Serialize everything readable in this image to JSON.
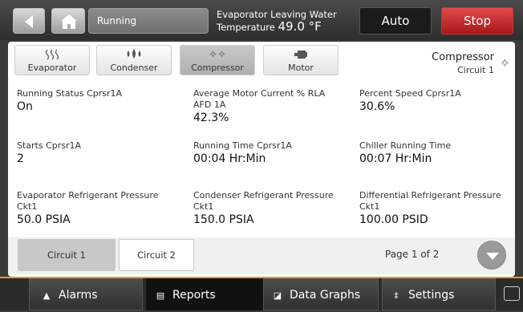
{
  "header": {
    "status": "Running",
    "evap_label": "Evaporator Leaving Water",
    "evap_temp_prefix": "Temperature",
    "evap_temp_value": "49.0 °F",
    "auto_label": "Auto",
    "stop_label": "Stop",
    "colors": {
      "stop": "#c62828",
      "accent": "#e69a1e"
    }
  },
  "tabs": [
    {
      "label": "Evaporator",
      "icon": "evaporator-icon"
    },
    {
      "label": "Condenser",
      "icon": "condenser-icon"
    },
    {
      "label": "Compressor",
      "icon": "compressor-icon",
      "active": true
    },
    {
      "label": "Motor",
      "icon": "motor-icon"
    }
  ],
  "component": {
    "title": "Compressor",
    "subtitle": "Circuit 1",
    "icon": "compressor-icon"
  },
  "readings": [
    {
      "label": "Running Status Cprsr1A",
      "value": "On"
    },
    {
      "label": "Average Motor Current % RLA",
      "label2": "AFD 1A",
      "value": "42.3%"
    },
    {
      "label": "Percent Speed Cprsr1A",
      "value": "30.6%"
    },
    {
      "label": "Starts Cprsr1A",
      "value": "2"
    },
    {
      "label": "Running Time Cprsr1A",
      "value": "00:04 Hr:Min"
    },
    {
      "label": "Chiller Running Time",
      "value": "00:07 Hr:Min"
    },
    {
      "label": "Evaporator Refrigerant Pressure",
      "label2": "Ckt1",
      "value": "50.0 PSIA"
    },
    {
      "label": "Condenser Refrigerant Pressure",
      "label2": "Ckt1",
      "value": "150.0 PSIA"
    },
    {
      "label": "Differential Refrigerant Pressure",
      "label2": "Ckt1",
      "value": "100.00 PSID"
    }
  ],
  "circuits": [
    "Circuit 1",
    "Circuit 2"
  ],
  "pagination": {
    "label": "Page 1 of 2"
  },
  "nav": [
    {
      "label": "Alarms",
      "icon": "bell-icon"
    },
    {
      "label": "Reports",
      "icon": "document-icon",
      "active": true
    },
    {
      "label": "Data Graphs",
      "icon": "graph-icon"
    },
    {
      "label": "Settings",
      "icon": "sliders-icon"
    }
  ]
}
